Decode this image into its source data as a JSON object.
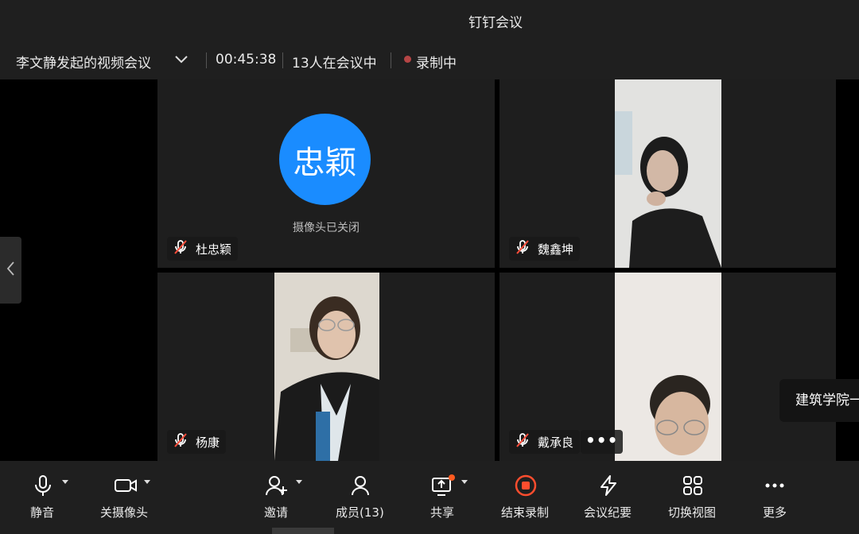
{
  "app": {
    "title": "钉钉会议"
  },
  "meeting": {
    "name": "李文静发起的视频会议",
    "elapsed": "00:45:38",
    "participants_status": "13人在会议中",
    "recording_status": "录制中"
  },
  "tiles": [
    {
      "name": "杜忠颖",
      "avatar_text": "忠颖",
      "camera_status": "摄像头已关闭",
      "muted": true
    },
    {
      "name": "魏鑫坤",
      "muted": true
    },
    {
      "name": "杨康",
      "muted": true
    },
    {
      "name": "戴承良",
      "muted": true
    }
  ],
  "floating_label": "建筑学院一",
  "toolbar": {
    "mute": "静音",
    "camera_off": "关摄像头",
    "invite": "邀请",
    "members": "成员(13)",
    "share": "共享",
    "end_recording": "结束录制",
    "minutes": "会议纪要",
    "switch_view": "切换视图",
    "more": "更多"
  },
  "colors": {
    "avatar": "#1a8cff",
    "record_dot": "#b54545",
    "end_record_icon": "#ff4d2e",
    "share_badge": "#ff5a1f"
  }
}
